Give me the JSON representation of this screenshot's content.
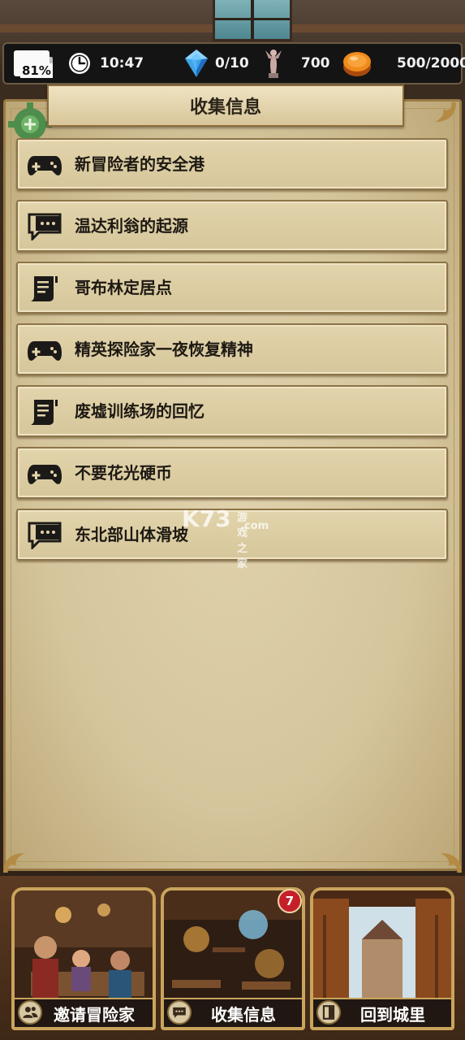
{
  "status_bar": {
    "battery": "81%",
    "time": "10:47",
    "gems": "0/10",
    "statues": "700",
    "coins": "500/2000"
  },
  "panel": {
    "title": "收集信息",
    "items": [
      {
        "label": "新冒险者的安全港",
        "icon": "gamepad-icon"
      },
      {
        "label": "温达利翁的起源",
        "icon": "chat-bubble-icon"
      },
      {
        "label": "哥布林定居点",
        "icon": "scroll-icon"
      },
      {
        "label": "精英探险家一夜恢复精神",
        "icon": "gamepad-icon"
      },
      {
        "label": "废墟训练场的回忆",
        "icon": "scroll-icon"
      },
      {
        "label": "不要花光硬币",
        "icon": "gamepad-icon"
      },
      {
        "label": "东北部山体滑坡",
        "icon": "chat-bubble-icon"
      }
    ]
  },
  "bottom_nav": [
    {
      "label": "邀请冒险家",
      "icon": "people-icon"
    },
    {
      "label": "收集信息",
      "icon": "chat-icon",
      "badge": "7"
    },
    {
      "label": "回到城里",
      "icon": "door-icon"
    }
  ],
  "watermark": {
    "main": "K73",
    "sub": "游戏之家",
    "domain": ".com"
  },
  "colors": {
    "parchment": "#d8c89f",
    "badge": "#c5202a",
    "frame": "#c9a45c"
  }
}
